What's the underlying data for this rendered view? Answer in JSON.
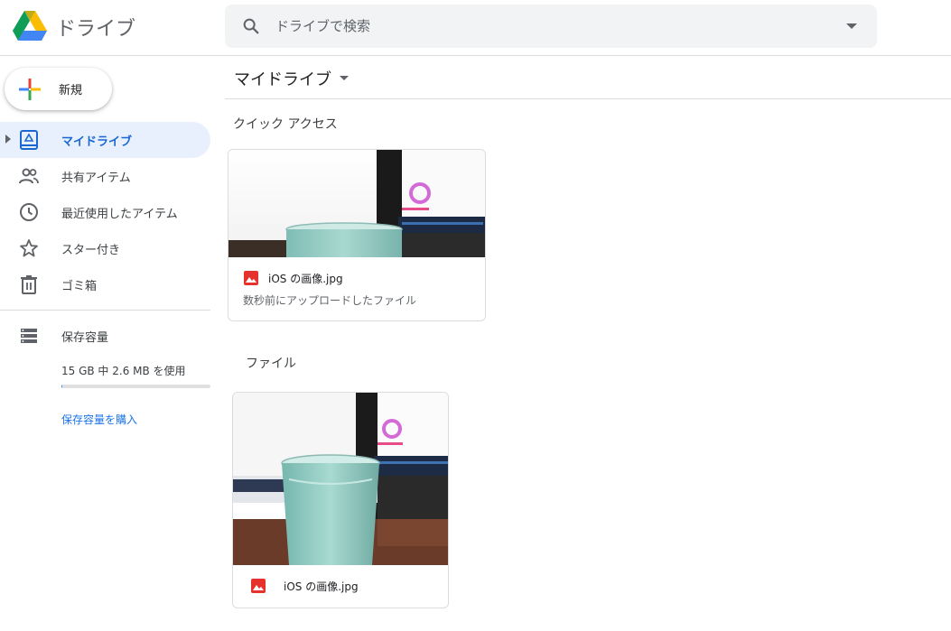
{
  "header": {
    "app_name": "ドライブ",
    "search": {
      "placeholder": "ドライブで検索",
      "value": ""
    }
  },
  "sidebar": {
    "new_label": "新規",
    "items": [
      {
        "label": "マイドライブ",
        "icon": "my-drive-icon",
        "active": true
      },
      {
        "label": "共有アイテム",
        "icon": "people-icon"
      },
      {
        "label": "最近使用したアイテム",
        "icon": "clock-icon"
      },
      {
        "label": "スター付き",
        "icon": "star-icon"
      },
      {
        "label": "ゴミ箱",
        "icon": "trash-icon"
      }
    ],
    "storage": {
      "label": "保存容量",
      "usage": "15 GB 中 2.6 MB を使用",
      "fraction_used": 0.0002,
      "buy_label": "保存容量を購入"
    }
  },
  "main": {
    "title": "マイドライブ",
    "quick_access": {
      "label": "クイック アクセス",
      "items": [
        {
          "name": "iOS の画像.jpg",
          "subtitle": "数秒前にアップロードしたファイル"
        }
      ]
    },
    "files": {
      "label": "ファイル",
      "items": [
        {
          "name": "iOS の画像.jpg"
        }
      ]
    }
  },
  "colors": {
    "accent": "#1967d2",
    "active_bg": "#e8f0fe",
    "image_icon": "#e5322d"
  }
}
